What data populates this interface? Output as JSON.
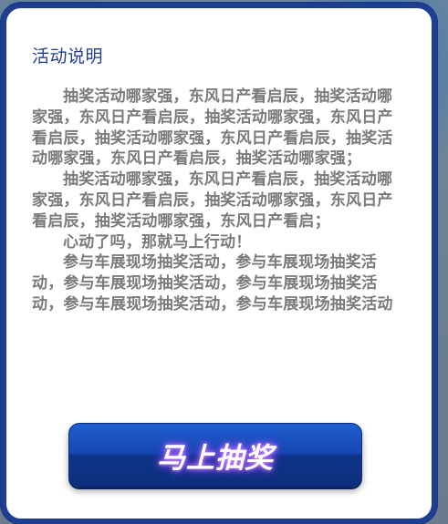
{
  "panel": {
    "title": "活动说明",
    "paragraphs": [
      "抽奖活动哪家强，东风日产看启辰，抽奖活动哪家强，东风日产看启辰，抽奖活动哪家强，东风日产看启辰，抽奖活动哪家强，东风日产看启辰，抽奖活动哪家强，东风日产看启辰，抽奖活动哪家强；",
      "抽奖活动哪家强，东风日产看启辰，抽奖活动哪家强，东风日产看启辰，抽奖活动哪家强，东风日产看启辰，抽奖活动哪家强，东风日产看启；",
      "心动了吗，那就马上行动！",
      "参与车展现场抽奖活动，参与车展现场抽奖活动，参与车展现场抽奖活动，参与车展现场抽奖活动，参与车展现场抽奖活动，参与车展现场抽奖活动"
    ],
    "cta_label": "马上抽奖"
  },
  "colors": {
    "border": "#1e3f91",
    "title": "#1f3e8e",
    "body_text": "#7a7a7a",
    "button": "#1646af"
  }
}
